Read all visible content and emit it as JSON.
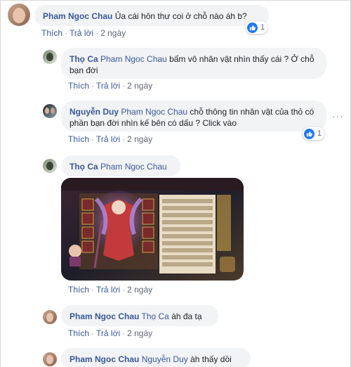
{
  "actions": {
    "like": "Thích",
    "reply": "Trả lời",
    "time": "2 ngày"
  },
  "comments": [
    {
      "author": "Pham Ngoc Chau",
      "tag": "",
      "text": "Ủa cái hôn thư coi ở chỗ nào áh b?",
      "likes": "1"
    },
    {
      "author": "Thọ Ca",
      "tag": "Pham Ngoc Chau",
      "text": "bấm vô nhân vật nhìn thấy cái ? Ở chỗ bạn đời"
    },
    {
      "author": "Nguyễn Duy",
      "tag": "Pham Ngoc Chau",
      "text": "chỗ thông tin nhân vật của thỏ có phần bạn đời nhìn kế bên có dấu ? Click vào",
      "likes": "1"
    },
    {
      "author": "Thọ Ca",
      "tag": "Pham Ngoc Chau",
      "text": ""
    },
    {
      "author": "Pham Ngoc Chau",
      "tag": "Thọ Ca",
      "text": "àh đa tạ"
    },
    {
      "author": "Pham Ngoc Chau",
      "tag": "Nguyễn Duy",
      "text": "àh thấy dồi"
    }
  ],
  "colors": {
    "link": "#385898",
    "bubble": "#f2f3f5",
    "like": "#2078f4"
  },
  "icons": [
    "thumbs-up-icon",
    "more-options-icon"
  ]
}
